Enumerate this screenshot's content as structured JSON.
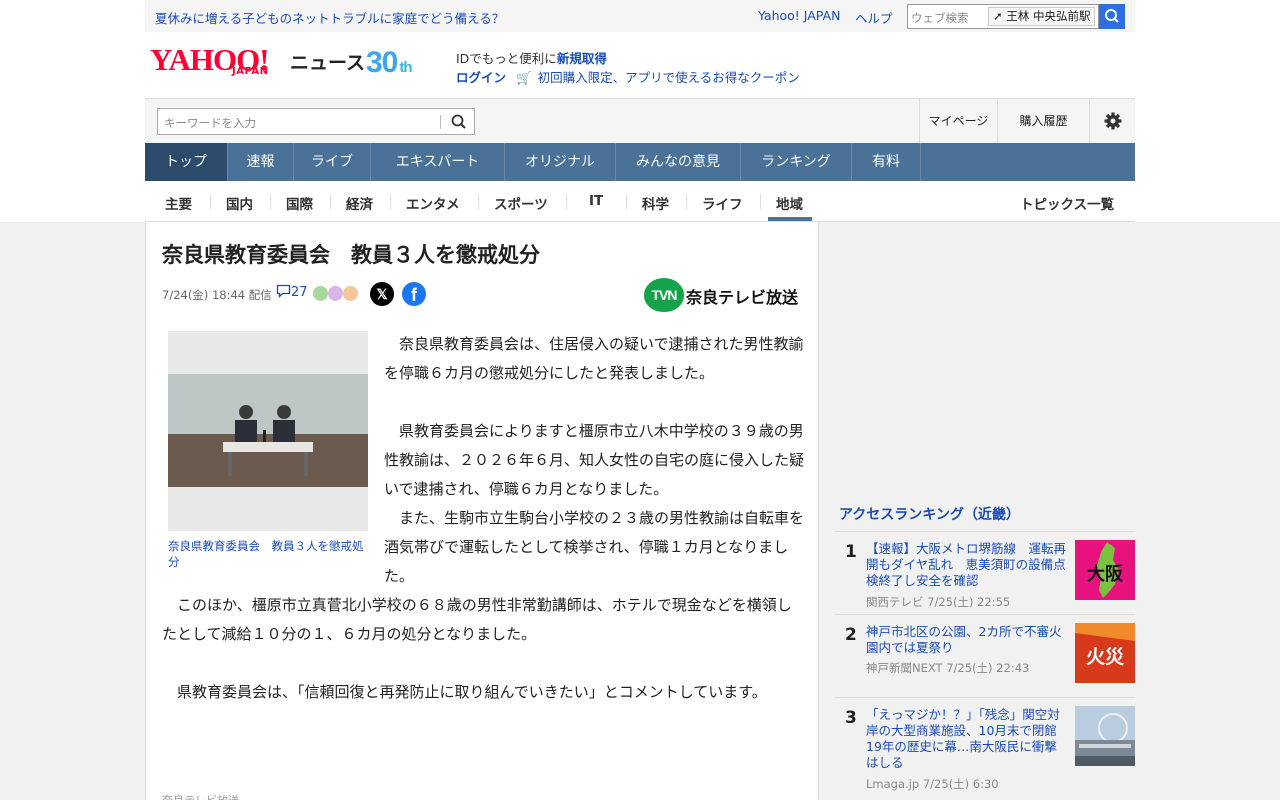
{
  "topbar": {
    "promo": "夏休みに増える子どものネットトラブルに家庭でどう備える？",
    "yahoo_japan": "Yahoo! JAPAN",
    "help": "ヘルプ",
    "web_search_placeholder": "ウェブ検索",
    "location": "王林 中央弘前駅"
  },
  "header": {
    "logo_main": "YAHOO!",
    "logo_sub": "JAPAN",
    "news": "ニュース",
    "anniversary": "30",
    "anniversary_suffix": "th",
    "id_text": "IDでもっと便利に",
    "id_link": "新規取得",
    "login": "ログイン",
    "coupon": "初回購入限定、アプリで使えるお得なクーポン"
  },
  "search": {
    "placeholder": "キーワードを入力",
    "mypage": "マイページ",
    "history": "購入履歴"
  },
  "global_nav": [
    "トップ",
    "速報",
    "ライブ",
    "エキスパート",
    "オリジナル",
    "みんなの意見",
    "ランキング",
    "有料"
  ],
  "sub_nav": {
    "items": [
      "主要",
      "国内",
      "国際",
      "経済",
      "エンタメ",
      "スポーツ",
      "IT",
      "科学",
      "ライフ",
      "地域"
    ],
    "active": "地域",
    "topics": "トピックス一覧"
  },
  "article": {
    "title": "奈良県教育委員会　教員３人を懲戒処分",
    "date": "7/24(金) 18:44",
    "distributed": "配信",
    "comment_count": "27",
    "source": "奈良テレビ放送",
    "source_mark": "TVN",
    "photo_caption": "奈良県教育委員会　教員３人を懲戒処分",
    "paragraphs": [
      "奈良県教育委員会は、住居侵入の疑いで逮捕された男性教諭を停職６カ月の懲戒処分にしたと発表しました。",
      "県教育委員会によりますと橿原市立八木中学校の３９歳の男性教諭は、２０２６年６月、知人女性の自宅の庭に侵入した疑いで逮捕され、停職６カ月となりました。",
      "また、生駒市立生駒台小学校の２３歳の男性教諭は自転車を酒気帯びで運転したとして検挙され、停職１カ月となりました。",
      "このほか、橿原市立真菅北小学校の６８歳の男性非常勤講師は、ホテルで現金などを横領したとして減給１０分の１、６カ月の処分となりました。",
      "県教育委員会は、「信頼回復と再発防止に取り組んでいきたい」とコメントしています。"
    ],
    "footer": "奈良テレビ放送"
  },
  "ranking": {
    "heading": "アクセスランキング（近畿）",
    "items": [
      {
        "rank": "1",
        "title": "【速報】大阪メトロ堺筋線　運転再開もダイヤ乱れ　恵美須町の設備点検終了し安全を確認",
        "source": "関西テレビ",
        "date": "7/25(土) 22:55",
        "thumb_text": "大阪",
        "thumb_color": "#e8127f"
      },
      {
        "rank": "2",
        "title": "神戸市北区の公園、2カ所で不審火　園内では夏祭り",
        "source": "神戸新聞NEXT",
        "date": "7/25(土) 22:43",
        "thumb_text": "火災",
        "thumb_color": "#d63a1a"
      },
      {
        "rank": "3",
        "title": "「えっマジか！？」「残念」関空対岸の大型商業施設、10月末で閉館　19年の歴史に幕…南大阪民に衝撃はしる",
        "source": "Lmaga.jp",
        "date": "7/25(土) 6:30",
        "thumb_text": "",
        "thumb_color": "#7a9ab8"
      }
    ]
  },
  "colors": {
    "accent_blue": "#1a4cb8",
    "nav_bg": "#4a7299",
    "nav_active": "#2c4b6b",
    "brand_red": "#ff0033"
  }
}
